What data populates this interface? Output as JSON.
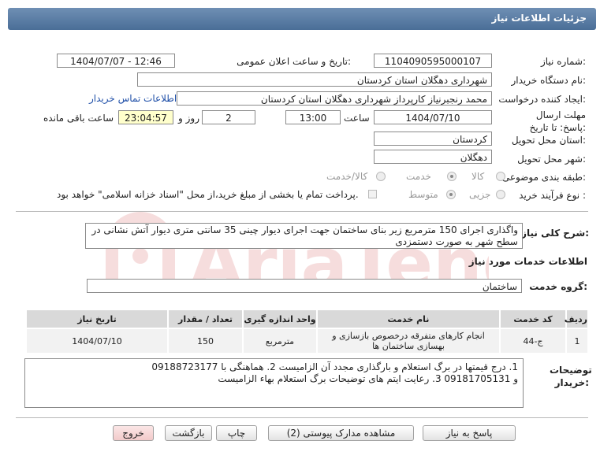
{
  "header": {
    "title": "جزئیات اطلاعات نیاز"
  },
  "fields": {
    "need_number_label": "شماره نیاز:",
    "need_number": "1104090595000107",
    "announce_label": "تاریخ و ساعت اعلان عمومی:",
    "announce_value": "1404/07/07 - 12:46",
    "buyer_org_label": "نام دستگاه خریدار:",
    "buyer_org": "شهرداری دهگلان استان کردستان",
    "creator_label": "ایجاد کننده درخواست:",
    "creator": "محمد رنجبرنیاز کارپرداز شهرداری دهگلان استان کردستان",
    "contact_link": "اطلاعات تماس خریدار",
    "deadline_label": "مهلت ارسال پاسخ: تا تاریخ:",
    "deadline_date": "1404/07/10",
    "time_label": "ساعت",
    "deadline_time": "13:00",
    "days_value": "2",
    "days_label": "روز و",
    "remaining_time": "23:04:57",
    "remaining_label": "ساعت باقی مانده",
    "province_label": "استان محل تحویل:",
    "province": "کردستان",
    "city_label": "شهر محل تحویل:",
    "city": "دهگلان",
    "category_label": "طبقه بندی موضوعی:",
    "category_options": [
      "کالا",
      "خدمت",
      "کالا/خدمت"
    ],
    "category_selected": "خدمت",
    "process_label": "نوع فرآیند خرید :",
    "process_options": [
      "جزیی",
      "متوسط"
    ],
    "process_selected": "متوسط",
    "payment_note": "پرداخت تمام یا بخشی از مبلغ خرید،از محل \"اسناد خزانه اسلامی\" خواهد بود."
  },
  "description": {
    "label": "شرح کلی نیاز:",
    "text": "واگذاری اجرای 150 مترمربع زیر بنای ساختمان جهت اجرای دیوار چینی 35 سانتی متری دیوار آتش نشانی در سطح شهر به صورت دستمزدی"
  },
  "services": {
    "section_title": "اطلاعات خدمات مورد نیاز",
    "group_label": "گروه خدمت:",
    "group_value": "ساختمان",
    "columns": [
      "ردیف",
      "کد خدمت",
      "نام خدمت",
      "واحد اندازه گیری",
      "تعداد / مقدار",
      "تاریخ نیاز"
    ],
    "rows": [
      {
        "row": "1",
        "code": "ج-44",
        "name": "انجام کارهای متفرقه درخصوص بازسازی و بهسازی ساختمان ها",
        "unit": "مترمربع",
        "qty": "150",
        "date": "1404/07/10"
      }
    ]
  },
  "buyer_notes": {
    "label": "توضیحات خریدار:",
    "line1": "1. درج قیمتها در برگ استعلام و بارگذاری مجدد آن الزامیست 2. هماهنگی با 09188723177",
    "line2": "و 09181705131     3. رعایت ایتم های توضیحات برگ استعلام بهاء الزامیست"
  },
  "buttons": {
    "reply": "پاسخ به نیاز",
    "docs": "مشاهده مدارک پیوستی (2)",
    "print": "چاپ",
    "back": "بازگشت",
    "exit": "خروج"
  },
  "watermark_text": "AriaTender.net",
  "colors": {
    "header": "#5a7ca5",
    "highlight": "#ffffcc",
    "exit_button": "#f7d7d7",
    "link": "#1f4fa8"
  }
}
